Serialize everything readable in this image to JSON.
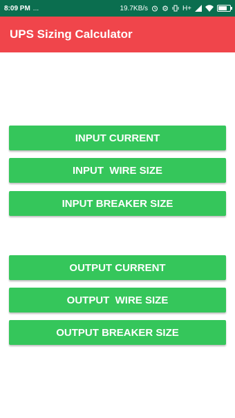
{
  "status_bar": {
    "time": "8:09 PM",
    "indicators": "...",
    "net_speed": "19.7KB/s",
    "alarm_icon": "alarm-icon",
    "settings_icon": "gear-icon",
    "vibrate_icon": "vibrate-icon",
    "network": "H+",
    "signal_icon": "signal-icon",
    "wifi_icon": "wifi-icon",
    "battery_icon": "battery-icon"
  },
  "app_bar": {
    "title": "UPS Sizing Calculator",
    "color": "#f0454b"
  },
  "buttons": {
    "input_current": "INPUT CURRENT",
    "input_wire_size": "INPUT  WIRE SIZE",
    "input_breaker_size": "INPUT BREAKER SIZE",
    "output_current": "OUTPUT CURRENT",
    "output_wire_size": "OUTPUT  WIRE SIZE",
    "output_breaker_size": "OUTPUT BREAKER SIZE",
    "color": "#35c65b"
  }
}
